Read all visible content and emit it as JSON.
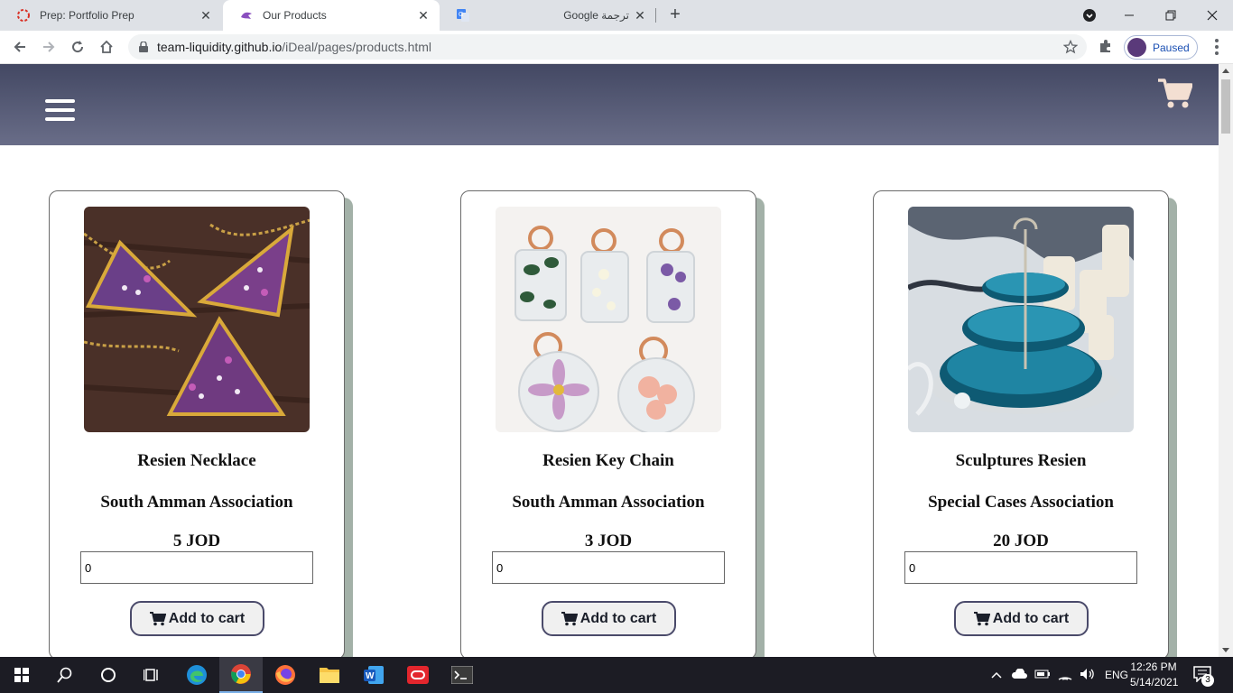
{
  "browser": {
    "tabs": [
      {
        "title": "Prep: Portfolio Prep",
        "favicon": "loading-ring-icon"
      },
      {
        "title": "Our Products",
        "favicon": "bird-icon"
      },
      {
        "title": "Google ترجمة",
        "favicon": "google-translate-icon"
      }
    ],
    "address": {
      "host": "team-liquidity.github.io",
      "path": "/iDeal/pages/products.html"
    },
    "profile_label": "Paused"
  },
  "site": {
    "header_colors": {
      "top": "#434863",
      "bottom": "#696d88"
    },
    "accent_shadow": "#a3b1a8"
  },
  "products": [
    {
      "name": "Resien Necklace",
      "association": "South Amman Association",
      "price": "5 JOD",
      "quantity": "0",
      "button": "Add to cart",
      "image": "resin-triangle-necklaces"
    },
    {
      "name": "Resien Key Chain",
      "association": "South Amman Association",
      "price": "3 JOD",
      "quantity": "0",
      "button": "Add to cart",
      "image": "resin-flower-keychains"
    },
    {
      "name": "Sculptures Resien",
      "association": "Special Cases Association",
      "price": "20 JOD",
      "quantity": "0",
      "button": "Add to cart",
      "image": "resin-tiered-tray"
    }
  ],
  "taskbar": {
    "apps": [
      "windows-start-icon",
      "search-icon",
      "cortana-icon",
      "task-view-icon",
      "edge-icon",
      "chrome-icon",
      "firefox-icon",
      "file-explorer-icon",
      "word-icon",
      "oracle-icon",
      "terminal-icon"
    ],
    "language": "ENG",
    "time": "12:26 PM",
    "date": "5/14/2021",
    "notification_count": "3"
  }
}
